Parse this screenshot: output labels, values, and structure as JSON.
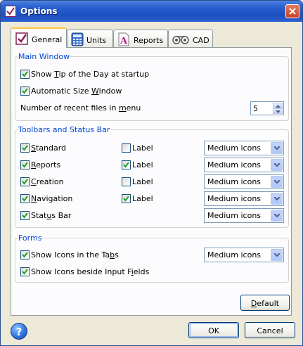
{
  "window": {
    "title": "Options"
  },
  "tabs": [
    {
      "label": "General",
      "icon": "checklist-icon",
      "active": true
    },
    {
      "label": "Units",
      "icon": "calculator-icon",
      "active": false
    },
    {
      "label": "Reports",
      "icon": "report-icon",
      "active": false
    },
    {
      "label": "CAD",
      "icon": "cad-icon",
      "active": false
    }
  ],
  "main_window": {
    "title": "Main Window",
    "show_tip": {
      "pre": "Show ",
      "key": "T",
      "post": "ip of the Day at startup",
      "checked": true
    },
    "auto_size": {
      "pre": "Automatic Size ",
      "key": "W",
      "post": "indow",
      "checked": true
    },
    "recent_files": {
      "pre": "Number of recent files in ",
      "key": "m",
      "post": "enu",
      "value": "5"
    }
  },
  "toolbars": {
    "title": "Toolbars and Status Bar",
    "rows": [
      {
        "pre": "",
        "key": "S",
        "post": "tandard",
        "checked": true,
        "label_text": "Label",
        "label_checked": false,
        "size": "Medium icons"
      },
      {
        "pre": "",
        "key": "R",
        "post": "eports",
        "checked": true,
        "label_text": "Label",
        "label_checked": true,
        "size": "Medium icons"
      },
      {
        "pre": "",
        "key": "C",
        "post": "reation",
        "checked": true,
        "label_text": "Label",
        "label_checked": false,
        "size": "Medium icons"
      },
      {
        "pre": "",
        "key": "N",
        "post": "avigation",
        "checked": true,
        "label_text": "Label",
        "label_checked": true,
        "size": "Medium icons"
      },
      {
        "pre": "Stat",
        "key": "u",
        "post": "s Bar",
        "checked": true,
        "size": "Medium icons"
      }
    ]
  },
  "forms": {
    "title": "Forms",
    "show_icons_tabs": {
      "pre": "Show Icons in the Ta",
      "key": "b",
      "post": "s",
      "checked": true,
      "size": "Medium icons"
    },
    "show_icons_fields": {
      "pre": "Show Icons beside Input F",
      "key": "i",
      "post": "elds",
      "checked": true
    }
  },
  "buttons": {
    "default": {
      "pre": "",
      "key": "D",
      "post": "efault"
    },
    "ok": "OK",
    "cancel": "Cancel",
    "help": "?"
  },
  "colors": {
    "group_title": "#0046d5",
    "tab_highlight": "#ffc73c",
    "titlebar": "#2a5fd0"
  }
}
